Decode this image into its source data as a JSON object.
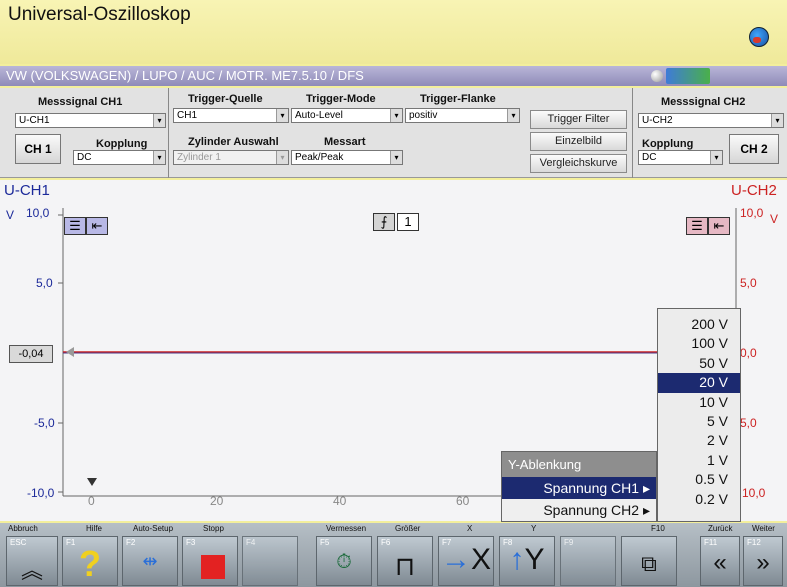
{
  "window": {
    "title": "Universal-Oszilloskop",
    "path": "VW (VOLKSWAGEN) / LUPO / AUC / MOTR. ME7.5.10 / DFS"
  },
  "controls": {
    "ch1_label": "Messsignal CH1",
    "ch1_value": "U-CH1",
    "ch1_button": "CH 1",
    "coupling_label": "Kopplung",
    "ch1_coupling": "DC",
    "trigger_source_label": "Trigger-Quelle",
    "trigger_source": "CH1",
    "trigger_mode_label": "Trigger-Mode",
    "trigger_mode": "Auto-Level",
    "trigger_edge_label": "Trigger-Flanke",
    "trigger_edge": "positiv",
    "cylinder_label": "Zylinder Auswahl",
    "cylinder": "Zylinder 1",
    "measure_label": "Messart",
    "measure": "Peak/Peak",
    "trigger_filter": "Trigger Filter",
    "single_image": "Einzelbild",
    "compare_curve": "Vergleichskurve",
    "ch2_label": "Messsignal CH2",
    "ch2_value": "U-CH2",
    "ch2_coupling_label": "Kopplung",
    "ch2_coupling": "DC",
    "ch2_button": "CH 2"
  },
  "scope": {
    "ch1_name": "U-CH1",
    "ch2_name": "U-CH2",
    "unit": "V",
    "y_left_ticks": [
      "10,0",
      "5,0",
      "-5,0",
      "-10,0"
    ],
    "y_right_ticks": [
      "10,0",
      "5,0",
      "0,0",
      "5,0",
      "10,0"
    ],
    "x_ticks": [
      "0",
      "20",
      "40",
      "60"
    ],
    "offset_value": "-0,04",
    "trigger_channel": "1",
    "ch1_color": "#1c2a9a",
    "ch2_color": "#cc2222"
  },
  "menu": {
    "title": "Y-Ablenkung",
    "items": [
      "Spannung CH1",
      "Spannung CH2"
    ],
    "voltages": [
      "200 V",
      "100 V",
      "50 V",
      "20 V",
      "10 V",
      "5 V",
      "2 V",
      "1 V",
      "0.5 V",
      "0.2 V"
    ],
    "selected_voltage": "20 V"
  },
  "fkeys": {
    "abbruch": "Abbruch",
    "esc": "ESC",
    "hilfe": "Hilfe",
    "f1": "F1",
    "autosetup": "Auto-Setup",
    "f2": "F2",
    "stopp": "Stopp",
    "f3": "F3",
    "f4": "F4",
    "vermessen": "Vermessen",
    "f5": "F5",
    "groesser": "Größer",
    "f6": "F6",
    "x": "X",
    "f7": "F7",
    "y": "Y",
    "f8": "F8",
    "f9": "F9",
    "f10": "F10",
    "zurueck": "Zurück",
    "f11": "F11",
    "weiter": "Weiter",
    "f12": "F12"
  }
}
